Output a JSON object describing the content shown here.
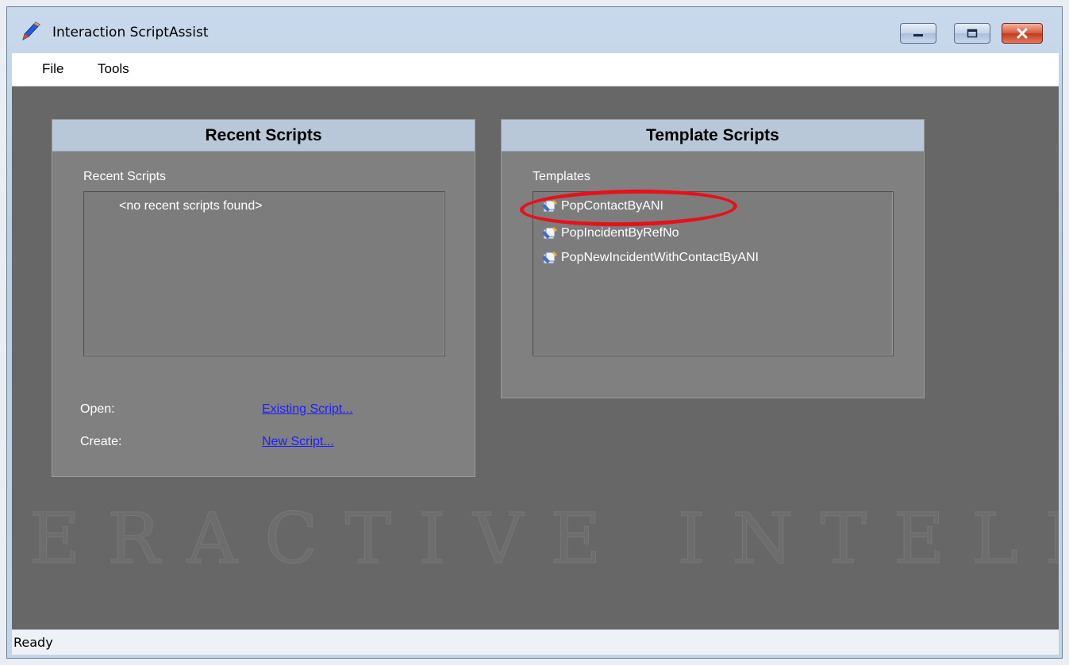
{
  "window": {
    "title": "Interaction ScriptAssist"
  },
  "menu": {
    "file": "File",
    "tools": "Tools"
  },
  "recent_panel": {
    "header": "Recent Scripts",
    "group_label": "Recent Scripts",
    "empty_message": "<no recent scripts found>",
    "open_label": "Open:",
    "open_link": "Existing Script...",
    "create_label": "Create:",
    "create_link": "New Script..."
  },
  "template_panel": {
    "header": "Template Scripts",
    "group_label": "Templates",
    "items": [
      {
        "label": "PopContactByANI",
        "highlighted": true
      },
      {
        "label": "PopIncidentByRefNo",
        "highlighted": false
      },
      {
        "label": "PopNewIncidentWithContactByANI",
        "highlighted": false
      }
    ]
  },
  "watermark": "ERACTIVE INTELLIGE",
  "status": {
    "text": "Ready"
  },
  "colors": {
    "client_bg": "#676767",
    "panel_bg": "#808080",
    "panel_header_bg": "#b9c8d9",
    "link": "#1e1eff",
    "highlight": "#e8101a"
  },
  "icons": {
    "app": "quill-icon",
    "template_item": "script-template-icon"
  }
}
